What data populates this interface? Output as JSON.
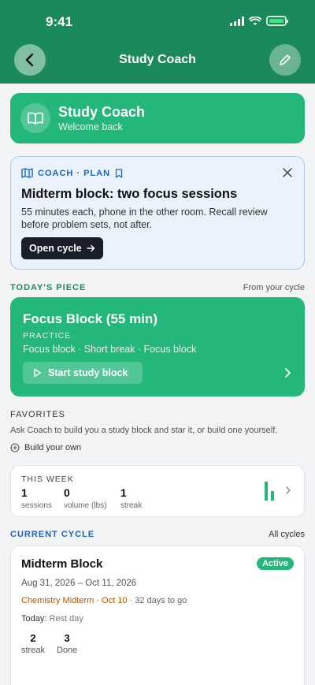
{
  "status": {
    "time": "9:41"
  },
  "header": {
    "title": "Study Coach"
  },
  "hero": {
    "title": "Study Coach",
    "subtitle": "Welcome back"
  },
  "coach_card": {
    "tag": "COACH · PLAN",
    "title": "Midterm block: two focus sessions",
    "text": "55 minutes each, phone in the other room. Recall review before problem sets, not after.",
    "button_label": "Open cycle"
  },
  "todays_piece": {
    "section_label": "TODAY'S PIECE",
    "section_right": "From your cycle",
    "title": "Focus Block (55 min)",
    "kind": "PRACTICE",
    "description": "Focus block · Short break · Focus block",
    "button_label": "Start study block"
  },
  "favorites": {
    "label": "FAVORITES",
    "text": "Ask Coach to build you a study block and star it, or build one yourself.",
    "build_label": "Build your own"
  },
  "this_week": {
    "label": "THIS WEEK",
    "stats": [
      {
        "value": "1",
        "label": "sessions"
      },
      {
        "value": "0",
        "label": "volume (lbs)"
      },
      {
        "value": "1",
        "label": "streak"
      }
    ]
  },
  "current_cycle": {
    "section_label": "CURRENT CYCLE",
    "section_right": "All cycles",
    "title": "Midterm Block",
    "badge": "Active",
    "dates": "Aug 31, 2026 – Oct 11, 2026",
    "event": "Chemistry Midterm · Oct 10",
    "days_to_go": "· 32 days to go",
    "today_label": "Today:",
    "today_value": "Rest day",
    "stats": [
      {
        "value": "2",
        "label": "streak"
      },
      {
        "value": "3",
        "label": "Done"
      }
    ]
  },
  "colors": {
    "header": "#1b8a5a",
    "accent": "#23b77a",
    "coach_bg": "#eaf2fc",
    "coach_accent": "#1e63c4",
    "cycle_label": "#1e63c4",
    "today_label": "#1b8a5a"
  }
}
